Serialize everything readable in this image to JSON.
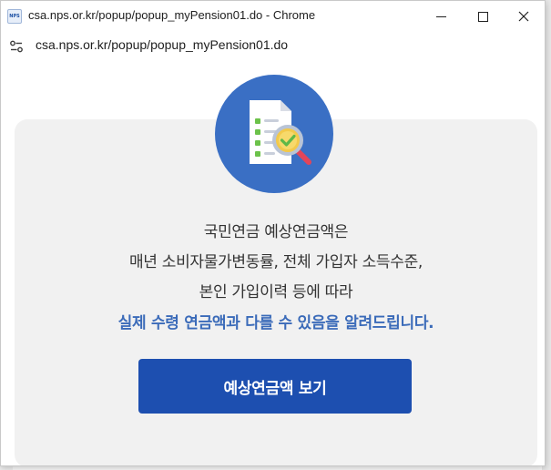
{
  "window": {
    "title": "csa.nps.or.kr/popup/popup_myPension01.do - Chrome",
    "favicon_text": "NPS",
    "buttons": {
      "minimize_icon": "minimize-icon",
      "maximize_icon": "maximize-icon",
      "close_icon": "close-icon"
    }
  },
  "addressbar": {
    "url": "csa.nps.or.kr/popup/popup_myPension01.do",
    "site_info_icon": "site-info-icon"
  },
  "popup": {
    "illustration_icon": "document-search-check-icon",
    "colors": {
      "badge": "#3a6fc4",
      "highlight": "#3b6bb9",
      "button": "#1d4fb0",
      "panel": "#f1f1f1"
    },
    "line1": "국민연금 예상연금액은",
    "line2": "매년 소비자물가변동률, 전체 가입자 소득수준,",
    "line3": "본인 가입이력 등에 따라",
    "highlight": "실제 수령 연금액과 다를 수 있음을 알려드립니다.",
    "button_label": "예상연금액 보기"
  }
}
